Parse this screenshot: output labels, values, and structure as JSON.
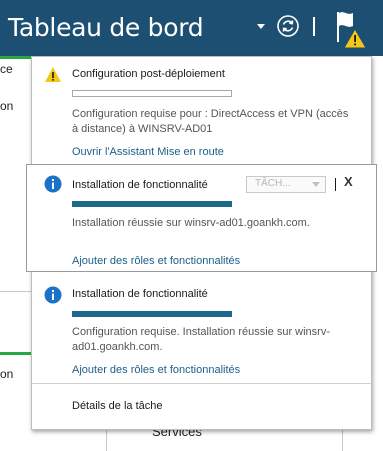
{
  "header": {
    "title": "Tableau de bord",
    "colors": {
      "bar": "#1d4f73",
      "text": "#ffffff",
      "warning": "#f5c518"
    },
    "icons": [
      "chevron-down-icon",
      "refresh-icon",
      "flag-icon",
      "warning-icon"
    ]
  },
  "background": {
    "frag1": "ce",
    "frag2": "on",
    "frag3": "on",
    "services": "Services",
    "accent": "#27a844"
  },
  "notifications": [
    {
      "icon": "warning-icon",
      "title": "Configuration post-déploiement",
      "progress": 0,
      "description": "Configuration requise pour : DirectAccess et VPN (accès à distance) à WINSRV-AD01",
      "link": "Ouvrir l'Assistant Mise en route"
    },
    {
      "icon": "info-icon",
      "title": "Installation de fonctionnalité",
      "progress": 1.0,
      "description": "Installation réussie sur winsrv-ad01.goankh.com.",
      "link": "Ajouter des rôles et fonctionnalités",
      "task_select": "TÂCH...",
      "close": "X"
    },
    {
      "icon": "info-icon",
      "title": "Installation de fonctionnalité",
      "progress": 1.0,
      "description": "Configuration requise. Installation réussie sur winsrv-ad01.goankh.com.",
      "link": "Ajouter des rôles et fonctionnalités"
    }
  ],
  "footer": {
    "details": "Détails de la tâche"
  },
  "colors": {
    "link": "#1b5f8a",
    "progress": "#1b6a8a",
    "info": "#1a73c9"
  }
}
